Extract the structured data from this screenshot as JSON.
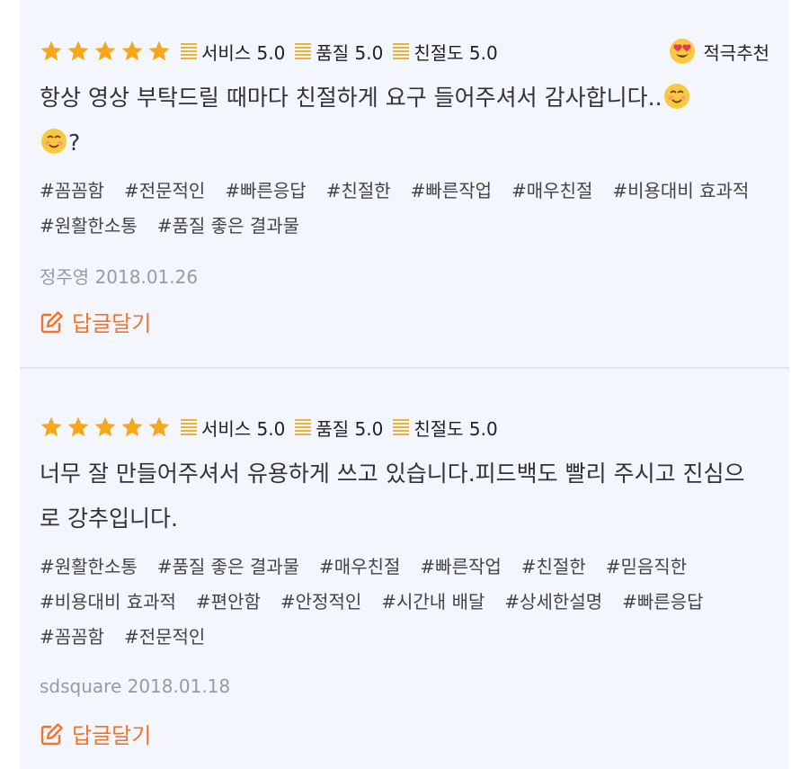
{
  "reviews": [
    {
      "stars": 5,
      "scores": [
        "서비스 5.0",
        "품질 5.0",
        "친절도 5.0"
      ],
      "badge": {
        "icon": "heart-eyes-emoji",
        "label": "적극추천"
      },
      "text_line1": "항상 영상 부탁드릴 때마다 친절하게 요구 들어주셔서 감사합니다..",
      "text_line2": "?",
      "tags": [
        "#꼼꼼함",
        "#전문적인",
        "#빠른응답",
        "#친절한",
        "#빠른작업",
        "#매우친절",
        "#비용대비 효과적",
        "#원활한소통",
        "#품질 좋은 결과물"
      ],
      "author": "정주영",
      "date": "2018.01.26",
      "reply_label": "답글달기"
    },
    {
      "stars": 5,
      "scores": [
        "서비스 5.0",
        "품질 5.0",
        "친절도 5.0"
      ],
      "text": "너무 잘 만들어주셔서 유용하게 쓰고 있습니다.피드백도 빨리 주시고 진심으로 강추입니다.",
      "tags": [
        "#원활한소통",
        "#품질 좋은 결과물",
        "#매우친절",
        "#빠른작업",
        "#친절한",
        "#믿음직한",
        "#비용대비 효과적",
        "#편안함",
        "#안정적인",
        "#시간내 배달",
        "#상세한설명",
        "#빠른응답",
        "#꼼꼼함",
        "#전문적인"
      ],
      "author": "sdsquare",
      "date": "2018.01.18",
      "reply_label": "답글달기"
    }
  ],
  "colors": {
    "star": "#f6a71c",
    "accent": "#f0742e",
    "panel": "#f4f6fd",
    "meta": "#9a9aa0"
  }
}
